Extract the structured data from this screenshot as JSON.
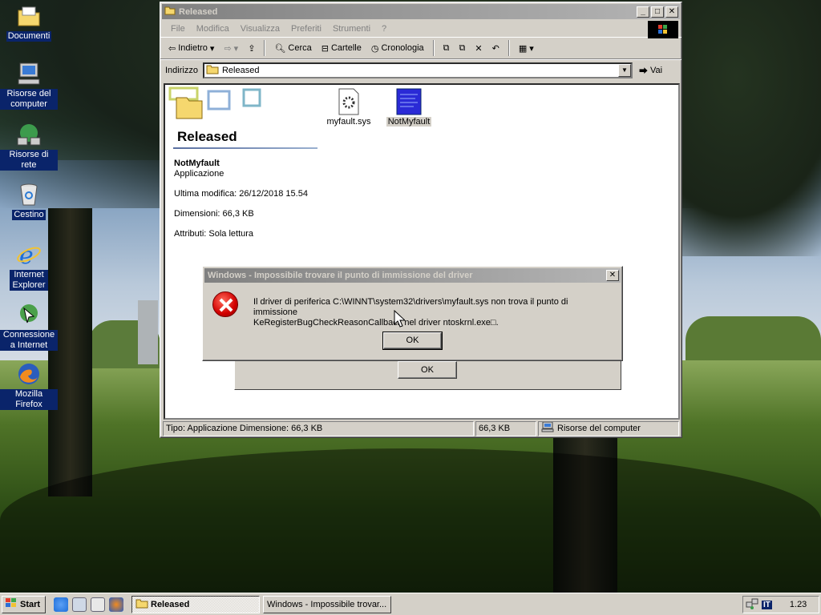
{
  "desktop": {
    "icons": [
      {
        "label": "Documenti",
        "icon": "folder-icon"
      },
      {
        "label": "Risorse del computer",
        "icon": "computer-icon"
      },
      {
        "label": "Risorse di rete",
        "icon": "network-icon"
      },
      {
        "label": "Cestino",
        "icon": "recycle-bin-icon"
      },
      {
        "label": "Internet Explorer",
        "icon": "internet-explorer-icon"
      },
      {
        "label": "Connessione a Internet",
        "icon": "connection-wizard-icon"
      },
      {
        "label": "Mozilla Firefox",
        "icon": "firefox-icon"
      }
    ]
  },
  "explorer": {
    "title": "Released",
    "menu": [
      "File",
      "Modifica",
      "Visualizza",
      "Preferiti",
      "Strumenti",
      "?"
    ],
    "toolbar": {
      "back": "Indietro",
      "search": "Cerca",
      "folders": "Cartelle",
      "history": "Cronologia"
    },
    "address_label": "Indirizzo",
    "address_value": "Released",
    "go_label": "Vai",
    "folder_title": "Released",
    "selected": {
      "name": "NotMyfault",
      "type": "Applicazione",
      "modified": "Ultima modifica: 26/12/2018 15.54",
      "size": "Dimensioni: 66,3 KB",
      "attributes": "Attributi: Sola lettura"
    },
    "files": [
      {
        "name": "myfault.sys",
        "icon": "system-file-icon"
      },
      {
        "name": "NotMyfault",
        "icon": "application-icon"
      }
    ],
    "status": {
      "left": "Tipo: Applicazione Dimensione: 66,3 KB",
      "size": "66,3 KB",
      "zone": "Risorse del computer"
    }
  },
  "back_dialog": {
    "ok": "OK"
  },
  "error_dialog": {
    "title": "Windows - Impossibile trovare il punto di immissione del driver",
    "line1": "Il driver di periferica C:\\WINNT\\system32\\drivers\\myfault.sys non trova il punto di immissione",
    "line2": "KeRegisterBugCheckReasonCallback nel driver ntoskrnl.exe□.",
    "ok": "OK"
  },
  "taskbar": {
    "start": "Start",
    "tasks": [
      "Released",
      "Windows - Impossibile trovar..."
    ],
    "lang": "IT",
    "clock": "1.23"
  },
  "colors": {
    "selection": "#0a246a",
    "face": "#d4d0c8",
    "error": "#d10000"
  }
}
